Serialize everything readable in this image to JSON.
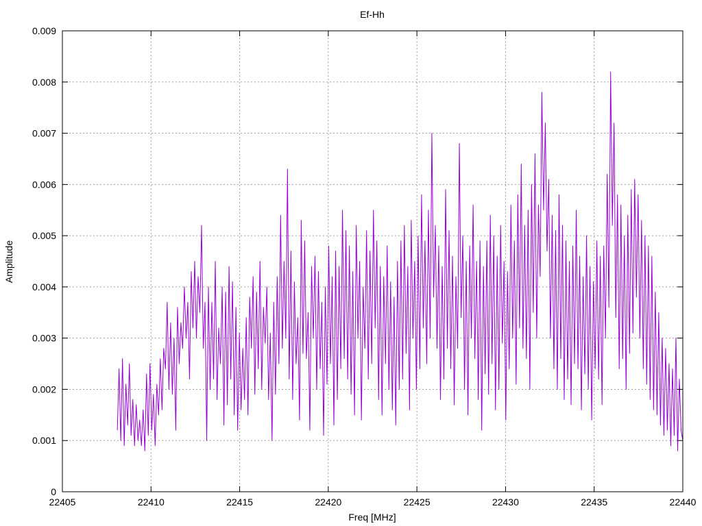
{
  "chart_data": {
    "type": "line",
    "title": "Ef-Hh",
    "xlabel": "Freq [MHz]",
    "ylabel": "Amplitude",
    "xlim": [
      22405,
      22440
    ],
    "ylim": [
      0,
      0.009
    ],
    "xticks": [
      "22405",
      "22410",
      "22415",
      "22420",
      "22425",
      "22430",
      "22435",
      "22440"
    ],
    "yticks": [
      "0",
      "0.001",
      "0.002",
      "0.003",
      "0.004",
      "0.005",
      "0.006",
      "0.007",
      "0.008",
      "0.009"
    ],
    "grid": true,
    "series": [
      {
        "color": "#9400d3",
        "x_start": 22408.1,
        "x_end": 22440.0,
        "x_step": 0.05,
        "values": [
          0.0012,
          0.0024,
          0.001,
          0.0026,
          0.0009,
          0.0021,
          0.0013,
          0.0025,
          0.0011,
          0.0018,
          0.0009,
          0.0017,
          0.001,
          0.0014,
          0.0009,
          0.0016,
          0.0008,
          0.0023,
          0.0011,
          0.0025,
          0.0012,
          0.0019,
          0.0009,
          0.0021,
          0.0015,
          0.0026,
          0.0016,
          0.0028,
          0.0024,
          0.0037,
          0.002,
          0.0033,
          0.0019,
          0.003,
          0.0012,
          0.0036,
          0.0025,
          0.0033,
          0.0028,
          0.004,
          0.003,
          0.0037,
          0.0022,
          0.0043,
          0.0032,
          0.0045,
          0.003,
          0.0042,
          0.0035,
          0.0052,
          0.0028,
          0.0037,
          0.001,
          0.004,
          0.002,
          0.0037,
          0.0022,
          0.0045,
          0.0018,
          0.0032,
          0.0025,
          0.004,
          0.0013,
          0.0039,
          0.0017,
          0.0044,
          0.0022,
          0.0041,
          0.0015,
          0.0036,
          0.0012,
          0.0031,
          0.0016,
          0.0028,
          0.0018,
          0.0034,
          0.0015,
          0.0038,
          0.0028,
          0.0042,
          0.0019,
          0.0039,
          0.0024,
          0.0045,
          0.002,
          0.0036,
          0.0029,
          0.004,
          0.0018,
          0.0031,
          0.001,
          0.0037,
          0.0019,
          0.0042,
          0.0025,
          0.0054,
          0.0028,
          0.0045,
          0.003,
          0.0063,
          0.0022,
          0.0047,
          0.0018,
          0.0041,
          0.0025,
          0.0034,
          0.0014,
          0.0053,
          0.0027,
          0.0049,
          0.0026,
          0.0035,
          0.0012,
          0.0044,
          0.003,
          0.0046,
          0.002,
          0.0043,
          0.0024,
          0.0037,
          0.0011,
          0.004,
          0.0021,
          0.0048,
          0.0025,
          0.0042,
          0.0013,
          0.0047,
          0.0018,
          0.0044,
          0.0024,
          0.0055,
          0.0026,
          0.0051,
          0.0022,
          0.0048,
          0.0019,
          0.0043,
          0.0015,
          0.0052,
          0.003,
          0.0045,
          0.0014,
          0.004,
          0.0028,
          0.0051,
          0.0022,
          0.0047,
          0.0025,
          0.0055,
          0.0032,
          0.0049,
          0.0018,
          0.0044,
          0.0015,
          0.0042,
          0.0025,
          0.0048,
          0.002,
          0.0041,
          0.0016,
          0.0038,
          0.0013,
          0.0045,
          0.002,
          0.0049,
          0.0022,
          0.0052,
          0.0027,
          0.0044,
          0.0016,
          0.0053,
          0.003,
          0.0045,
          0.002,
          0.005,
          0.0024,
          0.0058,
          0.0032,
          0.0049,
          0.0025,
          0.0055,
          0.003,
          0.007,
          0.0038,
          0.0052,
          0.0028,
          0.0048,
          0.0018,
          0.0044,
          0.0022,
          0.0059,
          0.0028,
          0.0051,
          0.0024,
          0.0046,
          0.0017,
          0.0042,
          0.0028,
          0.0068,
          0.0034,
          0.005,
          0.002,
          0.0045,
          0.0015,
          0.0048,
          0.003,
          0.0056,
          0.0026,
          0.0045,
          0.0018,
          0.0049,
          0.0012,
          0.0044,
          0.0023,
          0.0049,
          0.0019,
          0.0054,
          0.0025,
          0.005,
          0.0016,
          0.0046,
          0.002,
          0.0052,
          0.0029,
          0.0045,
          0.0014,
          0.0043,
          0.0024,
          0.0056,
          0.003,
          0.0049,
          0.0021,
          0.0058,
          0.0032,
          0.0064,
          0.0028,
          0.0052,
          0.0026,
          0.0055,
          0.002,
          0.006,
          0.0035,
          0.0066,
          0.003,
          0.0056,
          0.0042,
          0.0078,
          0.0055,
          0.0072,
          0.0047,
          0.0061,
          0.003,
          0.0054,
          0.0024,
          0.0051,
          0.002,
          0.0058,
          0.0026,
          0.0052,
          0.0018,
          0.0049,
          0.0022,
          0.0045,
          0.0017,
          0.0048,
          0.0025,
          0.0055,
          0.0024,
          0.0046,
          0.0016,
          0.0042,
          0.0023,
          0.005,
          0.002,
          0.0044,
          0.0014,
          0.0041,
          0.0024,
          0.0049,
          0.0022,
          0.0046,
          0.0017,
          0.0048,
          0.003,
          0.0062,
          0.0036,
          0.0082,
          0.0052,
          0.0072,
          0.0034,
          0.0058,
          0.0024,
          0.0056,
          0.0026,
          0.005,
          0.002,
          0.0054,
          0.0027,
          0.0059,
          0.0031,
          0.0061,
          0.0038,
          0.0058,
          0.003,
          0.0053,
          0.0024,
          0.005,
          0.0021,
          0.0048,
          0.0018,
          0.0046,
          0.0016,
          0.0039,
          0.0015,
          0.0035,
          0.0013,
          0.003,
          0.0011,
          0.0028,
          0.0012,
          0.0025,
          0.0009,
          0.0024,
          0.0011,
          0.003,
          0.0008,
          0.0022,
          0.0012,
          0.001
        ]
      }
    ]
  }
}
